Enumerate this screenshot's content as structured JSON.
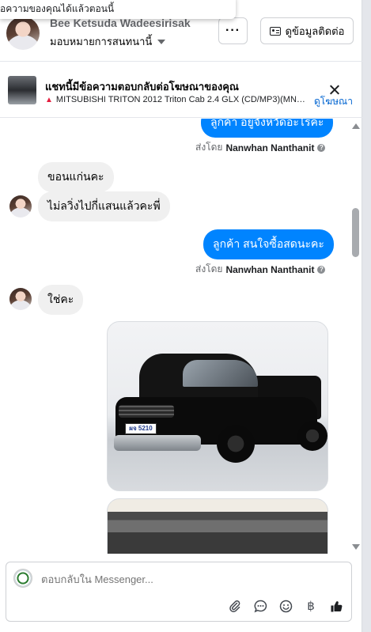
{
  "toast": {
    "text": "อความของคุณได้แล้วตอนนี้"
  },
  "header": {
    "name": "Bee Ketsuda Wadeesirisak",
    "assign_label": "มอบหมายการสนทนานี้",
    "more_label": "···",
    "contact_label": "ดูข้อมูลติดต่อ"
  },
  "ad": {
    "title": "แชทนี้มีข้อความตอบกลับต่อโฆษณาของคุณ",
    "description": "MITSUBISHI TRITON 2012 Triton Cab 2.4 GLX (CD/MP3)(MNC)( M...",
    "link_label": "ดูโฆษณา"
  },
  "messages": {
    "m1_text": "ลูกค้า อยู่จังหวัดอะไรคะ",
    "m1_sent_prefix": "ส่งโดย",
    "m1_sender": "Nanwhan Nanthanit",
    "m2_text": "ขอนแก่นคะ",
    "m3_text": "ไม่ลวิ่งไปกี่แสนแล้วคะพี่",
    "m4_text": "ลูกค้า สนใจซื้อสดนะคะ",
    "m4_sent_prefix": "ส่งโดย",
    "m4_sender": "Nanwhan Nanthanit",
    "m5_text": "ใช่คะ",
    "plate_text": "ผจ 5210"
  },
  "composer": {
    "placeholder": "ตอบกลับใน Messenger..."
  },
  "icons": {
    "attach": "paperclip-icon",
    "saved_replies": "chat-bubble-icon",
    "emoji": "smiley-icon",
    "payment": "baht-icon",
    "like": "thumbs-up-icon"
  },
  "colors": {
    "outgoing_bubble": "#0084ff",
    "incoming_bubble": "#f0f0f0",
    "link": "#0064d1"
  }
}
